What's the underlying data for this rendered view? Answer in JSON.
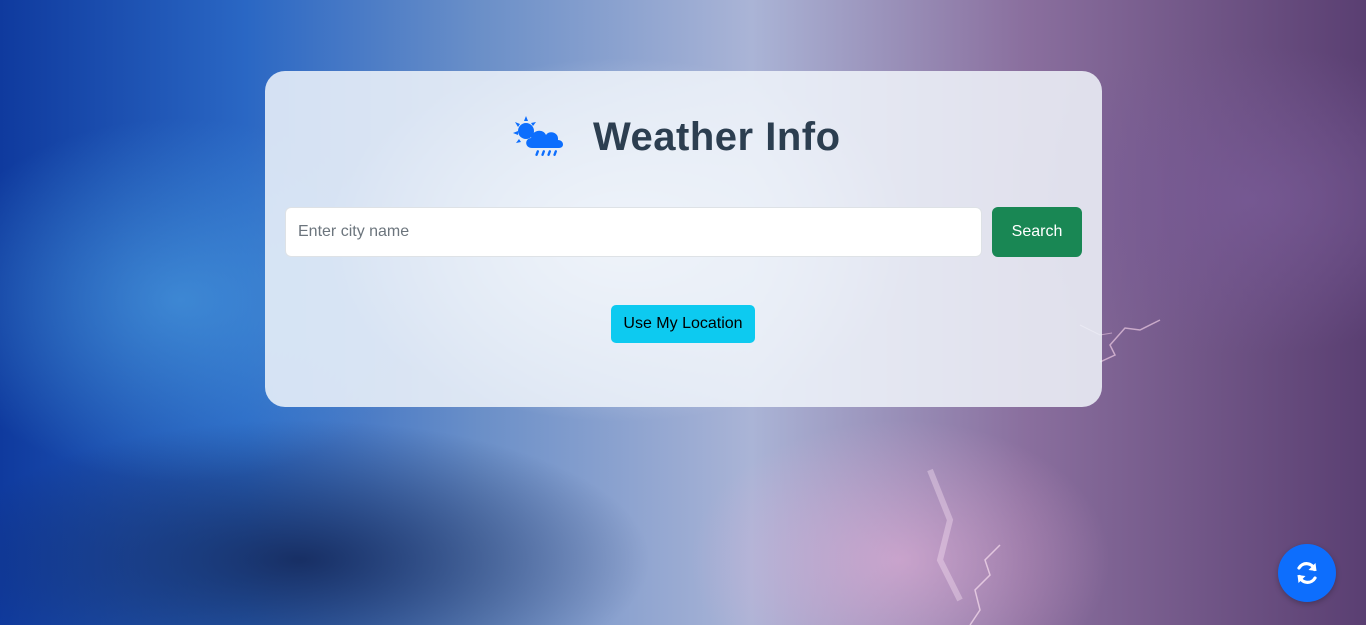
{
  "header": {
    "title": "Weather Info",
    "icon": "cloud-sun-rain-icon"
  },
  "search": {
    "placeholder": "Enter city name",
    "value": "",
    "button_label": "Search"
  },
  "location": {
    "button_label": "Use My Location"
  },
  "fab": {
    "icon": "refresh-icon"
  },
  "colors": {
    "accent": "#0d6efd",
    "search_button": "#198754",
    "location_button": "#0dcaf0",
    "title": "#2c3e50"
  }
}
